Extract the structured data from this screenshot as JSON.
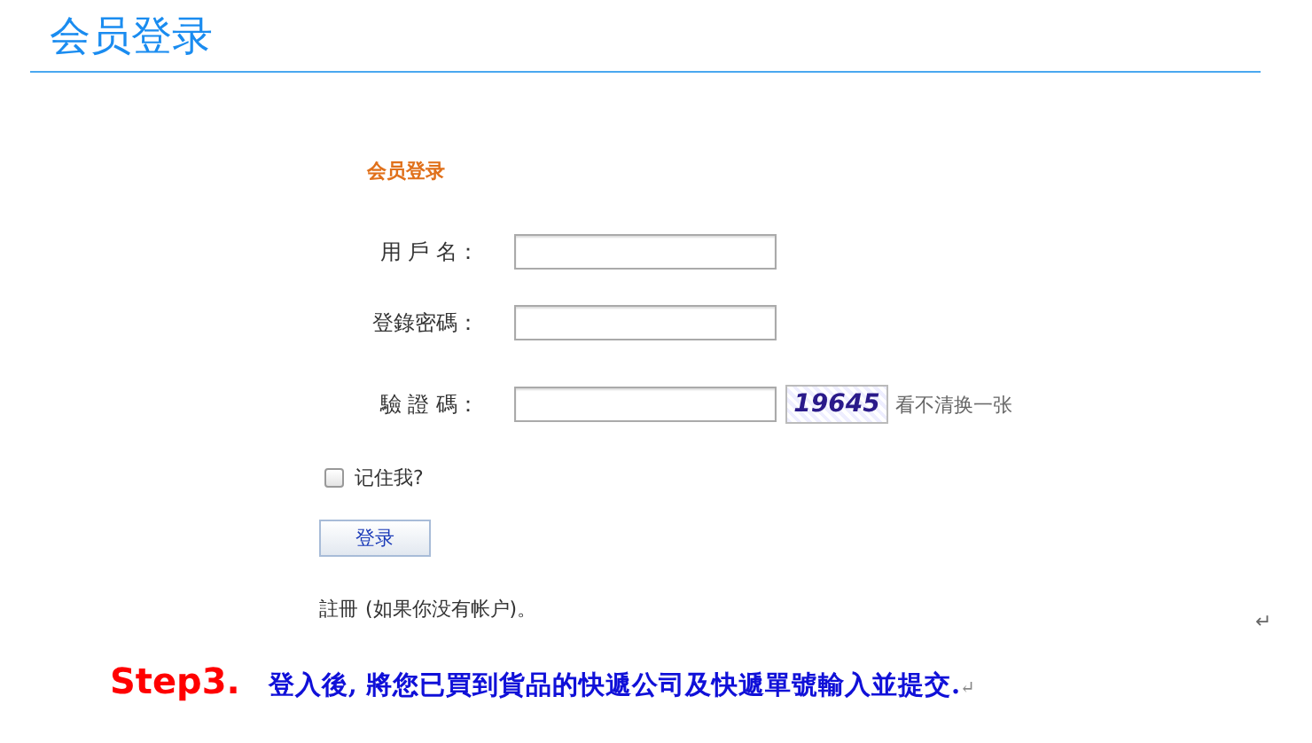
{
  "header": {
    "title": "会员登录"
  },
  "form": {
    "heading": "会员登录",
    "fields": [
      {
        "label": "用 戶 名：",
        "kind": "text"
      },
      {
        "label": "登錄密碼：",
        "kind": "text"
      },
      {
        "label": "驗 證 碼：",
        "kind": "captcha"
      }
    ],
    "captcha": {
      "code": "19645",
      "refresh": "看不清换一张"
    },
    "remember": {
      "label": "记住我?",
      "checked": false
    },
    "submit": "登录",
    "register": {
      "link": "註冊",
      "note": "(如果你没有帐户)。"
    }
  },
  "mark": "↵",
  "instruction": {
    "step": "Step3.",
    "text": "登入後, 將您已買到貨品的快遞公司及快遞單號輸入並提交.",
    "mark": "↵"
  }
}
